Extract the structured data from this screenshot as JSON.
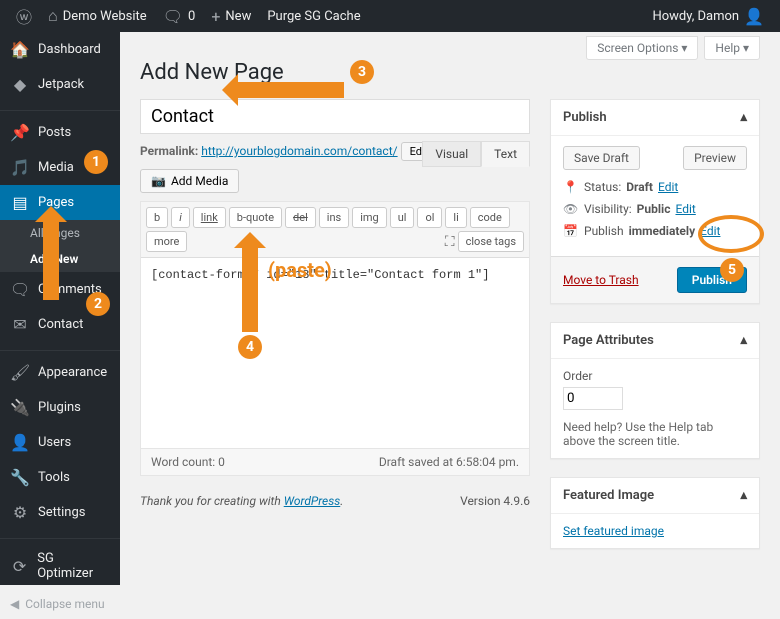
{
  "adminbar": {
    "site": "Demo Website",
    "comments": "0",
    "new": "New",
    "purge": "Purge SG Cache",
    "greeting": "Howdy, Damon"
  },
  "sidebar": {
    "items": [
      "Dashboard",
      "Jetpack",
      "Posts",
      "Media",
      "Pages",
      "Comments",
      "Contact",
      "Appearance",
      "Plugins",
      "Users",
      "Tools",
      "Settings",
      "SG Optimizer"
    ],
    "submenu": [
      "All Pages",
      "Add New"
    ],
    "collapse": "Collapse menu"
  },
  "top": {
    "screen": "Screen Options ▾",
    "help": "Help ▾"
  },
  "page": {
    "heading": "Add New Page",
    "title": "Contact",
    "permalink_label": "Permalink:",
    "permalink_url": "http://yourblogdomain.com/contact/",
    "edit": "Edit",
    "addmedia": "Add Media",
    "tabs": {
      "visual": "Visual",
      "text": "Text"
    },
    "toolbar": [
      "b",
      "i",
      "link",
      "b-quote",
      "del",
      "ins",
      "img",
      "ul",
      "ol",
      "li",
      "code",
      "more",
      "close tags"
    ],
    "content": "[contact-form-7 id=\"18\" title=\"Contact form 1\"]",
    "wordcount": "Word count: 0",
    "draftstatus": "Draft saved at 6:58:04 pm."
  },
  "publish": {
    "title": "Publish",
    "savedraft": "Save Draft",
    "preview": "Preview",
    "status_lbl": "Status:",
    "status_val": "Draft",
    "edit": "Edit",
    "vis_lbl": "Visibility:",
    "vis_val": "Public",
    "pub_lbl": "Publish",
    "pub_val": "immediately",
    "trash": "Move to Trash",
    "publish_btn": "Publish"
  },
  "attrs": {
    "title": "Page Attributes",
    "order": "Order",
    "order_val": "0",
    "help": "Need help? Use the Help tab above the screen title."
  },
  "featured": {
    "title": "Featured Image",
    "link": "Set featured image"
  },
  "footer": {
    "thank": "Thank you for creating with ",
    "wp": "WordPress",
    "version": "Version 4.9.6"
  },
  "annotations": {
    "paste": "(paste)"
  }
}
